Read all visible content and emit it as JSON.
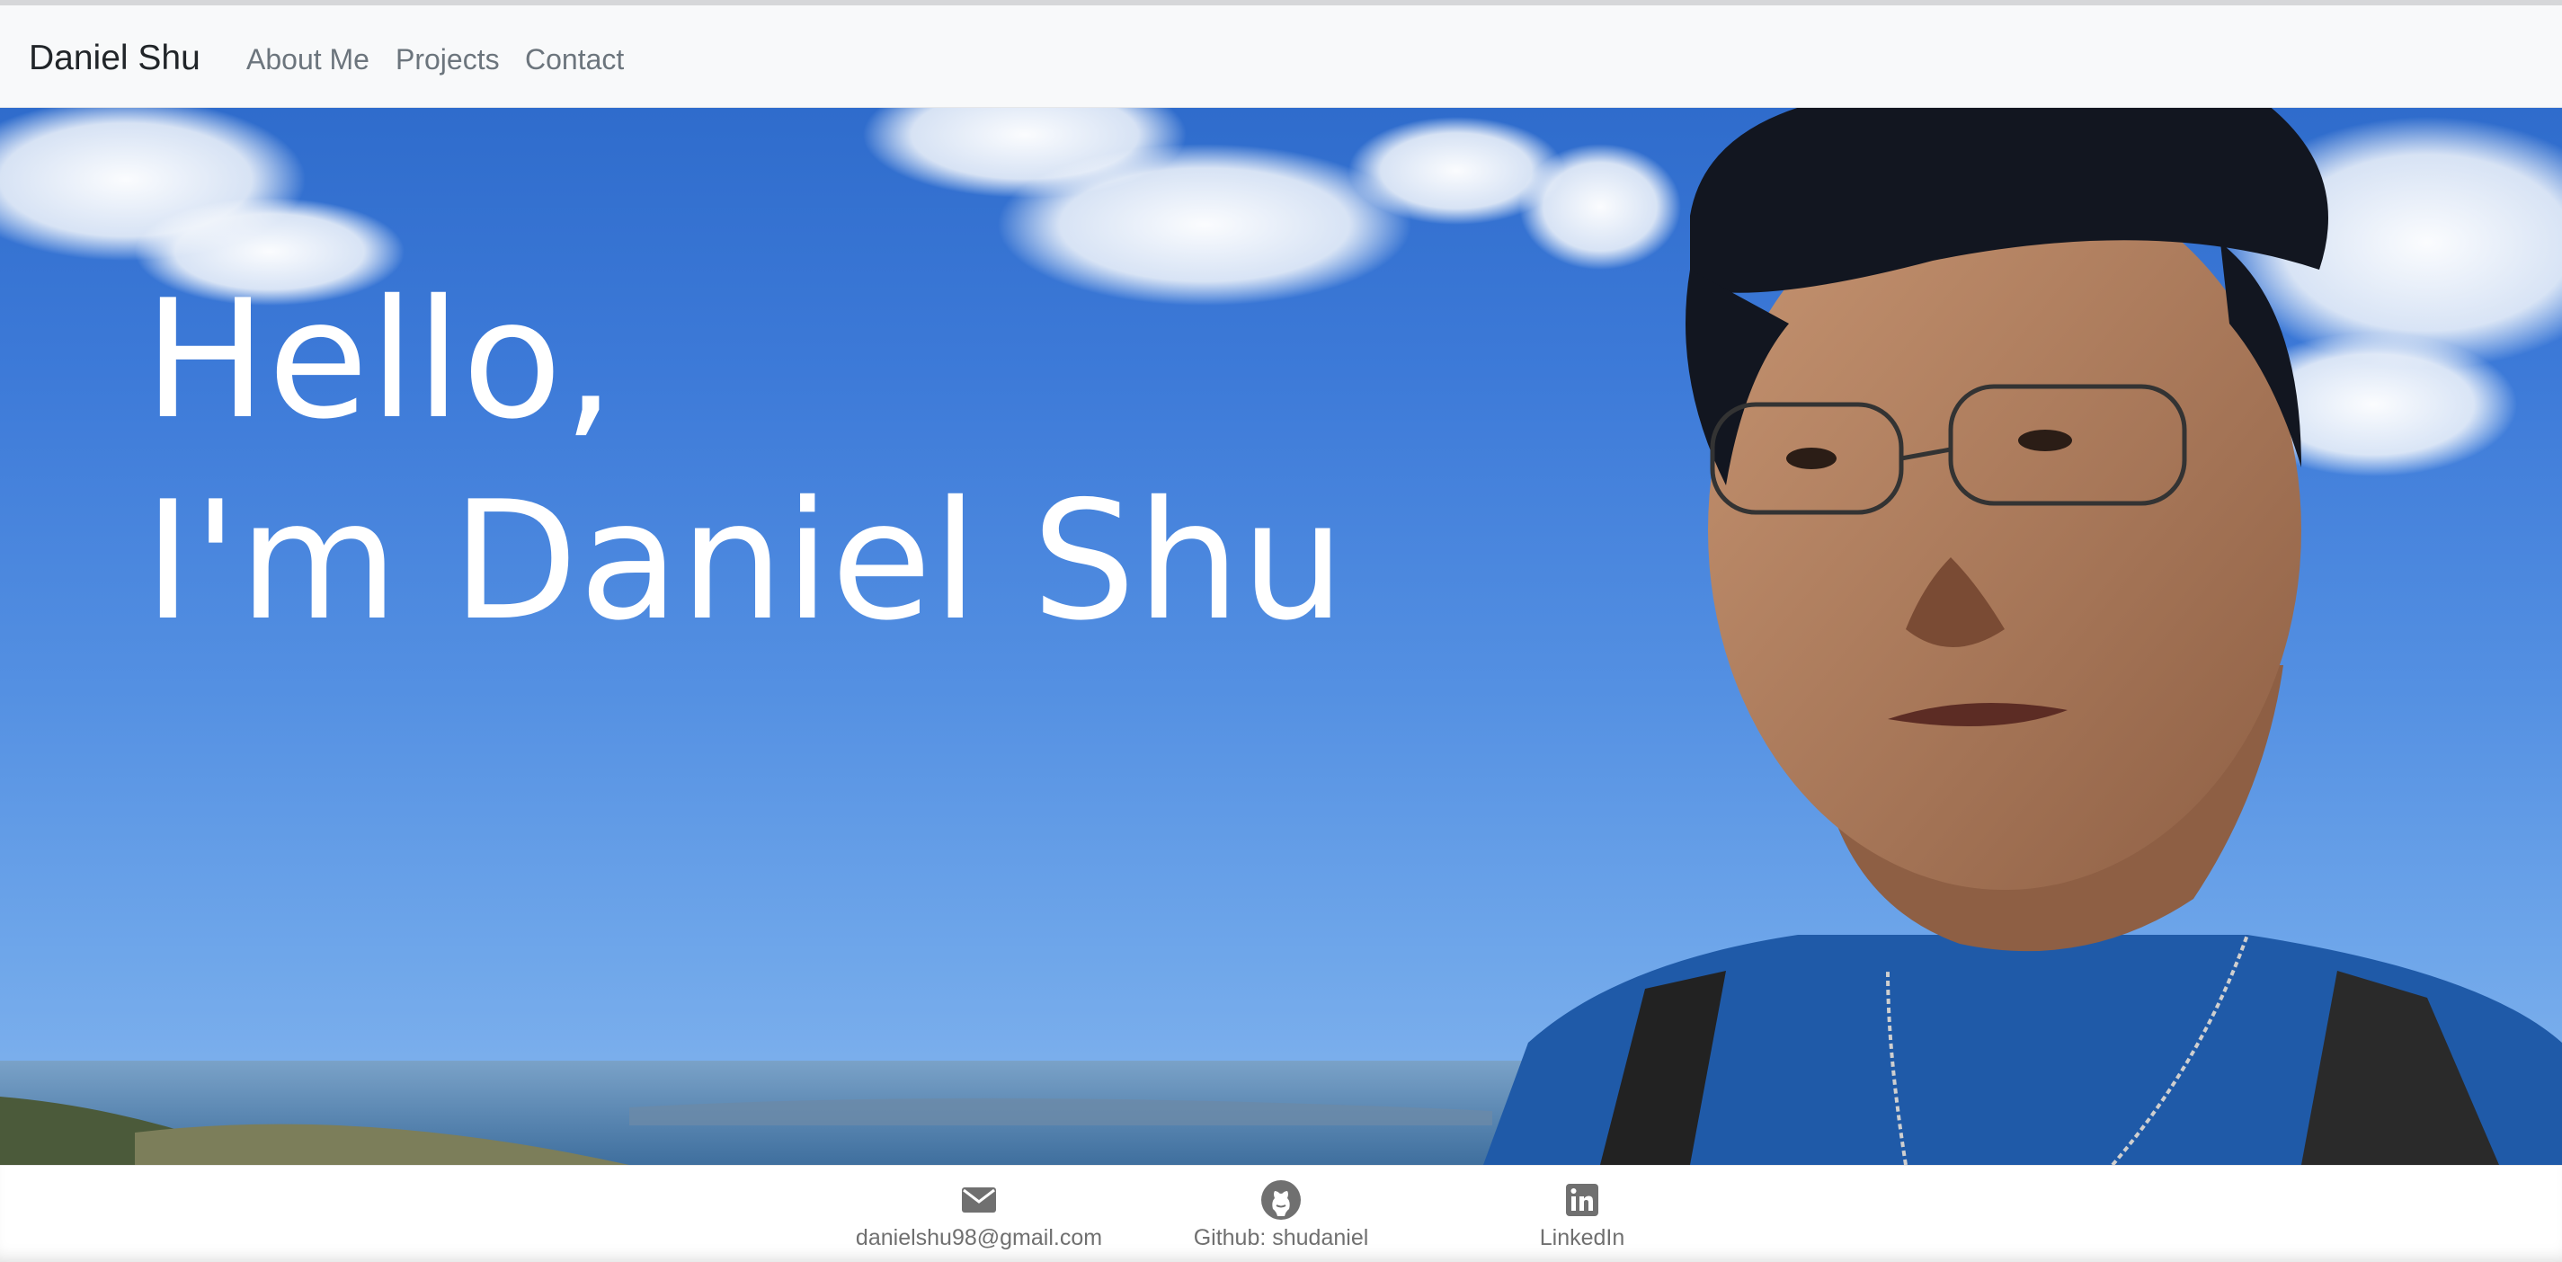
{
  "navbar": {
    "brand": "Daniel Shu",
    "links": [
      "About Me",
      "Projects",
      "Contact"
    ]
  },
  "hero": {
    "line1": "Hello,",
    "line2": "I'm Daniel Shu"
  },
  "footer": {
    "contacts": [
      {
        "icon": "envelope-icon",
        "label": "danielshu98@gmail.com"
      },
      {
        "icon": "github-icon",
        "label": "Github: shudaniel"
      },
      {
        "icon": "linkedin-icon",
        "label": "LinkedIn"
      }
    ]
  },
  "colors": {
    "navbar_bg": "#f8f9fa",
    "nav_link": "#6c757d",
    "brand": "#212529",
    "hero_text": "#ffffff",
    "footer_text": "#707070",
    "sky": "#3d7ad8"
  }
}
